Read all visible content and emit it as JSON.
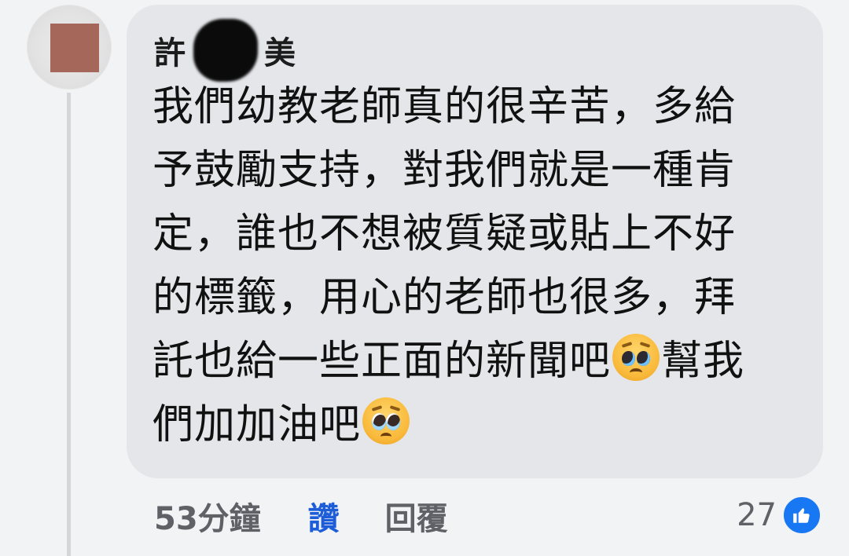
{
  "comment": {
    "author_visible_start": "許",
    "author_visible_end": "美",
    "lines": [
      "我們幼教老師真的很辛苦，多給",
      "予鼓勵支持，對我們就是一種肯",
      "定，誰也不想被質疑或貼上不好",
      "的標籤，用心的老師也很多，拜"
    ],
    "line5_before": "託也給一些正面的新聞吧",
    "line5_after": "幫我",
    "line6_before": "們加加油吧",
    "emojis": [
      "pleading-face",
      "pleading-face-tears"
    ]
  },
  "actions": {
    "timestamp": "53分鐘",
    "like_label": "讚",
    "reply_label": "回覆"
  },
  "reactions": {
    "count": "27",
    "icon": "thumbs-up-icon"
  },
  "colors": {
    "background": "#f2f3f5",
    "bubble": "#e4e6ea",
    "like_blue": "#1d5ed8",
    "reaction_blue": "#1877f2",
    "meta_gray": "#5f6167",
    "avatar_fill": "#a4675a"
  }
}
